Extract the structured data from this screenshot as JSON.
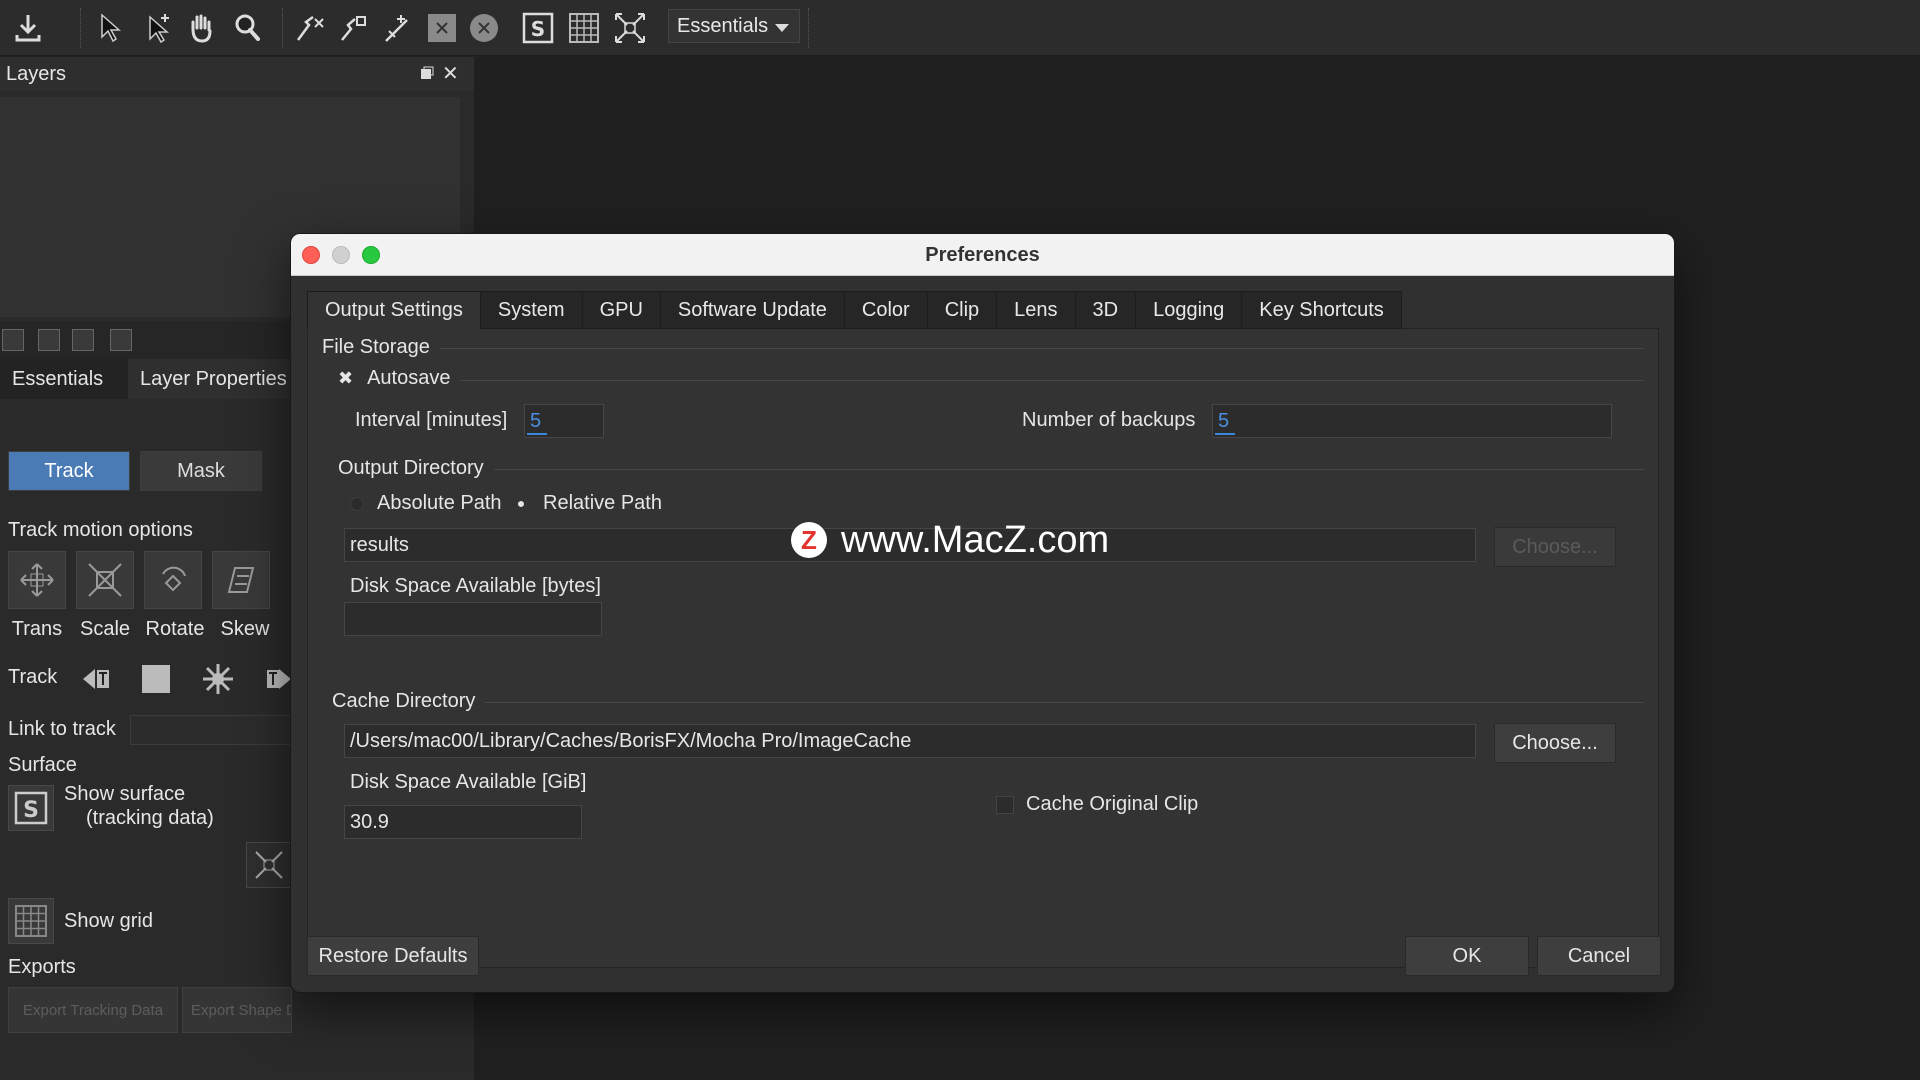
{
  "toolbar": {
    "workspace": "Essentials",
    "icons": [
      "download-icon",
      "select-arrow-icon",
      "add-point-arrow-icon",
      "hand-icon",
      "zoom-icon",
      "add-x-spline-icon",
      "add-bezier-icon",
      "pen-icon",
      "x-box-icon",
      "x-circle-icon",
      "surface-icon",
      "grid-icon",
      "planar-corners-icon"
    ]
  },
  "layers": {
    "title": "Layers",
    "close_glyph": "✕"
  },
  "panel": {
    "tabs": [
      "Essentials",
      "Layer Properties"
    ],
    "track_label": "Track",
    "mask_label": "Mask",
    "motion_title": "Track motion options",
    "motion": [
      "Trans",
      "Scale",
      "Rotate",
      "Skew"
    ],
    "track_row_label": "Track",
    "link_label": "Link to track",
    "surface_title": "Surface",
    "show_surface_line1": "Show surface",
    "show_surface_line2": "(tracking data)",
    "show_grid": "Show grid",
    "exports_title": "Exports",
    "export_tracking": "Export Tracking Data",
    "export_shape": "Export Shape Data"
  },
  "dialog": {
    "title": "Preferences",
    "tabs": [
      "Output Settings",
      "System",
      "GPU",
      "Software Update",
      "Color",
      "Clip",
      "Lens",
      "3D",
      "Logging",
      "Key Shortcuts"
    ],
    "file_storage": "File Storage",
    "autosave_glyph": "✖",
    "autosave_label": "Autosave",
    "interval_label": "Interval [minutes]",
    "interval_value": "5",
    "backups_label": "Number of backups",
    "backups_value": "5",
    "output_dir_title": "Output Directory",
    "absolute_path": "Absolute Path",
    "relative_path": "Relative Path",
    "output_dir_value": "results",
    "choose_label": "Choose...",
    "disk_bytes_label": "Disk Space Available [bytes]",
    "disk_bytes_value": "",
    "cache_dir_title": "Cache Directory",
    "cache_dir_value": "/Users/mac00/Library/Caches/BorisFX/Mocha Pro/ImageCache",
    "disk_gib_label": "Disk Space Available [GiB]",
    "disk_gib_value": "30.9",
    "cache_original_clip": "Cache Original Clip",
    "restore_defaults": "Restore Defaults",
    "ok": "OK",
    "cancel": "Cancel"
  },
  "watermark": {
    "logo": "Z",
    "text": "www.MacZ.com"
  },
  "colors": {
    "accent": "#4a7bb5",
    "close_light": "#fe5f57",
    "min_light": "#d0d0d0",
    "max_light": "#28c840",
    "spin_value": "#4a90e2"
  }
}
